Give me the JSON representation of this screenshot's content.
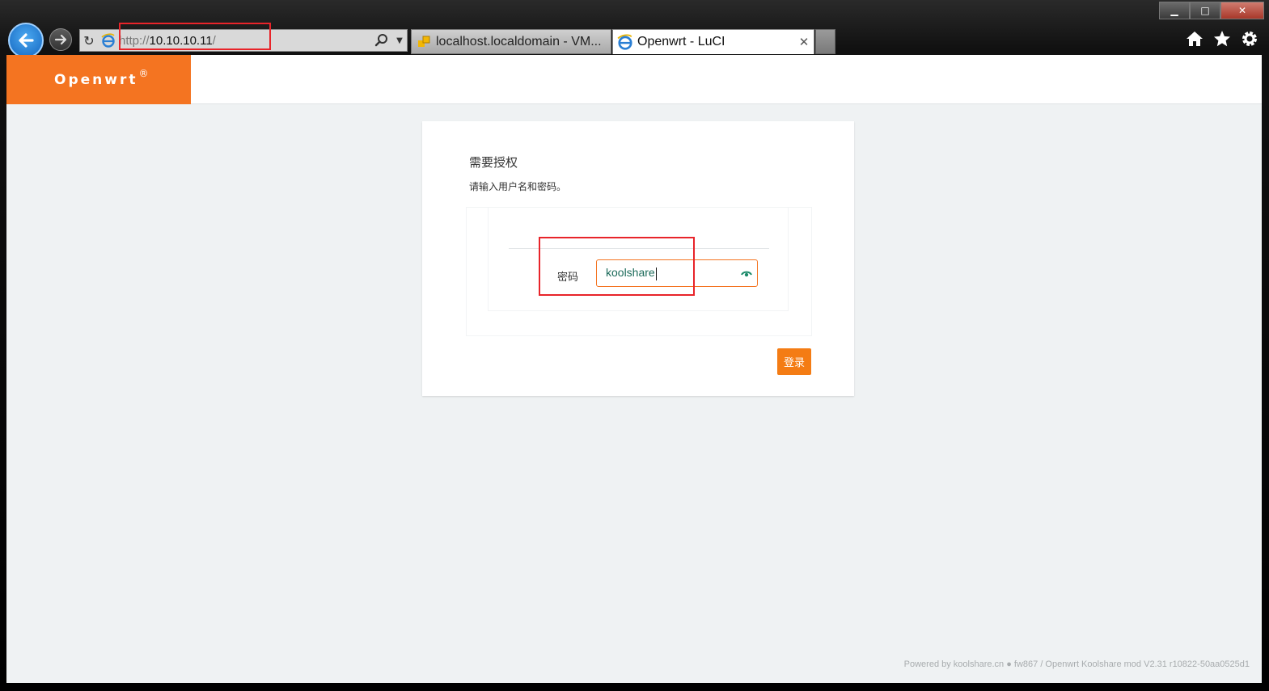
{
  "window": {
    "controls": {
      "minimize": "▁",
      "maximize": "□",
      "close": "✕"
    }
  },
  "address_bar": {
    "scheme": "http://",
    "host": "10.10.10.11",
    "path": "/"
  },
  "tabs": [
    {
      "label": "localhost.localdomain - VM...",
      "icon": "vmware-icon",
      "active": false
    },
    {
      "label": "Openwrt - LuCI",
      "icon": "ie-icon",
      "active": true,
      "close": "✕"
    }
  ],
  "header": {
    "brand": "Openwrt",
    "brand_mark": "®",
    "brand_color": "#f47421"
  },
  "login": {
    "title": "需要授权",
    "description": "请输入用户名和密码。",
    "password_label": "密码",
    "password_value": "koolshare",
    "submit_label": "登录",
    "accent_color": "#f47421"
  },
  "footer": {
    "text": "Powered by koolshare.cn ● fw867 / Openwrt Koolshare mod V2.31 r10822-50aa0525d1"
  }
}
